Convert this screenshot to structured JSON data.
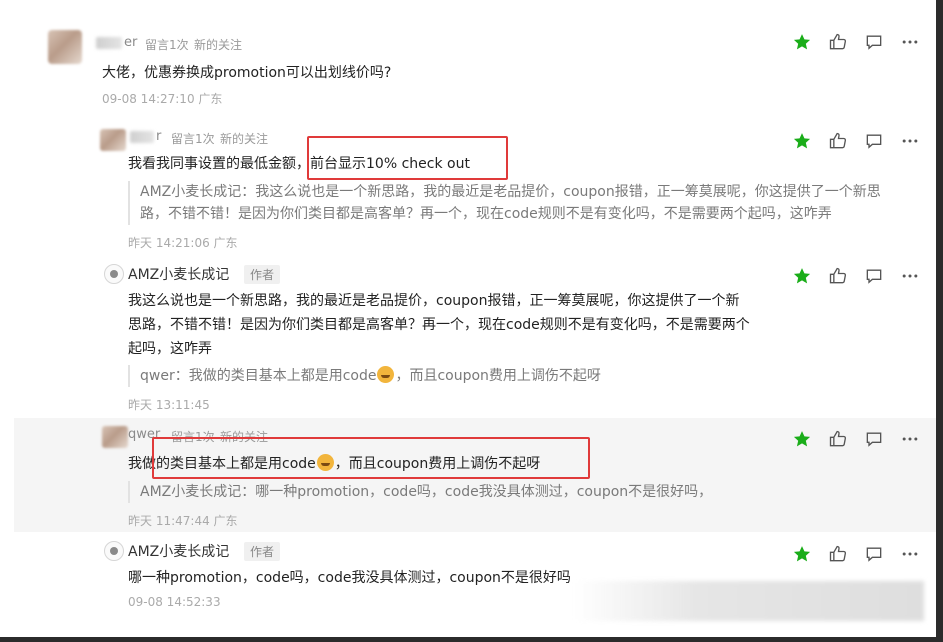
{
  "colors": {
    "star_green": "#1aad19",
    "highlight_red": "#e03a3a",
    "row_highlight": "#f5f5f5"
  },
  "comments": [
    {
      "user": {
        "name_visible": "er",
        "tag1": "留言1次",
        "tag2": "新的关注"
      },
      "body": "大佬，优惠券换成promotion可以出划线价吗?",
      "time": "09-08 14:27:10 广东"
    },
    {
      "user": {
        "name_visible": "r",
        "tag1": "留言1次",
        "tag2": "新的关注"
      },
      "body_a": "我看我同事设置的最低金额，",
      "body_b": "前台显示10% check out",
      "quote_line1": "AMZ小麦长成记：我这么说也是一个新思路，我的最近是老品提价，coupon报错，正一筹莫展呢，你这提供了一个新思",
      "quote_line2": "路，不错不错！是因为你们类目都是高客单？再一个，现在code规则不是有变化吗，不是需要两个起吗，这咋弄",
      "time": "昨天 14:21:06 广东"
    },
    {
      "user": {
        "name": "AMZ小麦长成记",
        "role": "作者"
      },
      "body_line1": "我这么说也是一个新思路，我的最近是老品提价，coupon报错，正一筹莫展呢，你这提供了一个新",
      "body_line2": "思路，不错不错！是因为你们类目都是高客单？再一个，现在code规则不是有变化吗，不是需要两个",
      "body_line3": "起吗，这咋弄",
      "quote_a": "qwer：我做的类目基本上都是用code",
      "quote_b": "，而且coupon费用上调伤不起呀",
      "time": "昨天 13:11:45"
    },
    {
      "user": {
        "name": "qwer",
        "tag1": "留言1次",
        "tag2": "新的关注"
      },
      "body_a": "我做的类目基本上都是用code",
      "body_b": "，而且coupon费用上调伤不起呀",
      "quote": "AMZ小麦长成记：哪一种promotion，code吗，code我没具体测过，coupon不是很好吗，",
      "time": "昨天 11:47:44 广东"
    },
    {
      "user": {
        "name": "AMZ小麦长成记",
        "role": "作者"
      },
      "body": "哪一种promotion，code吗，code我没具体测过，coupon不是很好吗",
      "time": "09-08 14:52:33"
    }
  ],
  "actions": {
    "star_icon": "star-icon",
    "like_icon": "thumbs-up-icon",
    "reply_icon": "comment-icon",
    "more_icon": "more-dots-icon"
  }
}
